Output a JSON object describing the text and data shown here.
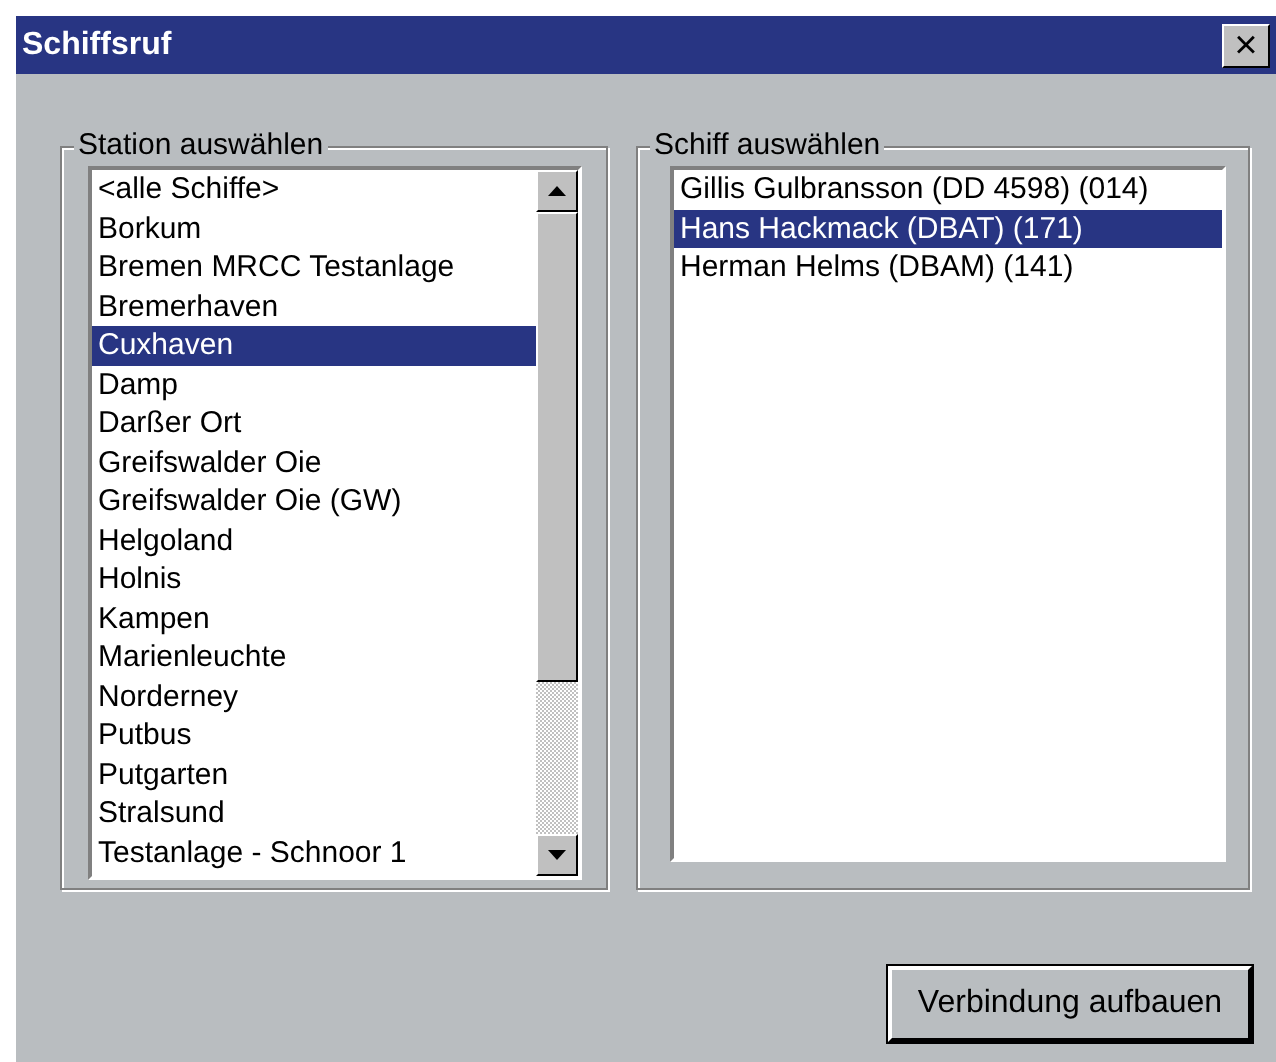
{
  "window": {
    "title": "Schiffsruf",
    "close": "×"
  },
  "stations": {
    "label": "Station auswählen",
    "items": [
      {
        "text": "<alle Schiffe>",
        "selected": false
      },
      {
        "text": "Borkum",
        "selected": false
      },
      {
        "text": "Bremen MRCC Testanlage",
        "selected": false
      },
      {
        "text": "Bremerhaven",
        "selected": false
      },
      {
        "text": "Cuxhaven",
        "selected": true
      },
      {
        "text": "Damp",
        "selected": false
      },
      {
        "text": "Darßer Ort",
        "selected": false
      },
      {
        "text": "Greifswalder Oie",
        "selected": false
      },
      {
        "text": "Greifswalder Oie (GW)",
        "selected": false
      },
      {
        "text": "Helgoland",
        "selected": false
      },
      {
        "text": "Holnis",
        "selected": false
      },
      {
        "text": "Kampen",
        "selected": false
      },
      {
        "text": "Marienleuchte",
        "selected": false
      },
      {
        "text": "Norderney",
        "selected": false
      },
      {
        "text": "Putbus",
        "selected": false
      },
      {
        "text": "Putgarten",
        "selected": false
      },
      {
        "text": "Stralsund",
        "selected": false
      },
      {
        "text": "Testanlage - Schnoor 1",
        "selected": false
      }
    ]
  },
  "ships": {
    "label": "Schiff auswählen",
    "items": [
      {
        "text": "Gillis Gulbransson (DD 4598) (014)",
        "selected": false
      },
      {
        "text": "Hans Hackmack (DBAT) (171)",
        "selected": true
      },
      {
        "text": "Herman Helms (DBAM) (141)",
        "selected": false
      }
    ]
  },
  "button": "Verbindung aufbauen"
}
